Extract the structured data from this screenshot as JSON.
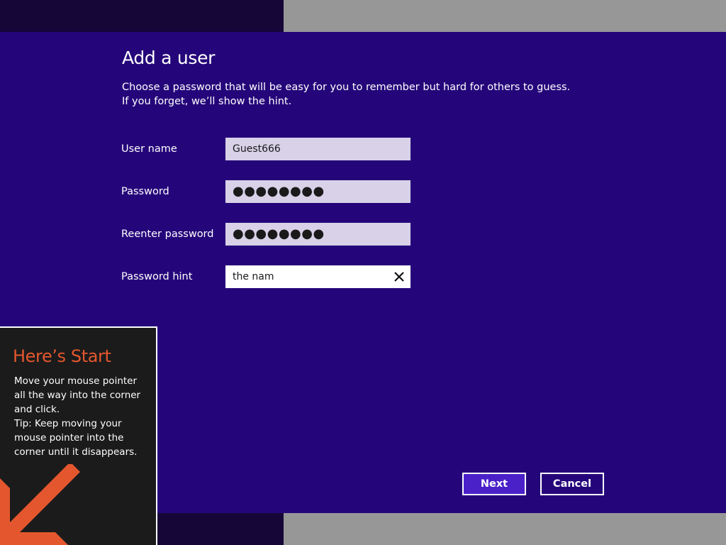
{
  "dialog": {
    "title": "Add a user",
    "subtitle": "Choose a password that will be easy for you to remember but hard for others to guess. If you forget, we’ll show the hint."
  },
  "form": {
    "username": {
      "label": "User name",
      "value": "Guest666"
    },
    "password": {
      "label": "Password",
      "value": "●●●●●●●●"
    },
    "reenter_password": {
      "label": "Reenter password",
      "value": "●●●●●●●●"
    },
    "hint": {
      "label": "Password hint",
      "value": "the nam",
      "clear_icon": "close-icon"
    }
  },
  "buttons": {
    "next": "Next",
    "cancel": "Cancel"
  },
  "tip": {
    "title": "Here’s Start",
    "line1": "Move your mouse pointer all the way into the corner and click.",
    "line2": "Tip: Keep moving your mouse pointer into the corner until it disappears.",
    "arrow_icon": "arrow-down-left-icon"
  },
  "colors": {
    "dialog_bg": "#25067a",
    "accent": "#4a20c9",
    "tip_title": "#e4572e",
    "tip_bg": "#1b1b1b"
  }
}
